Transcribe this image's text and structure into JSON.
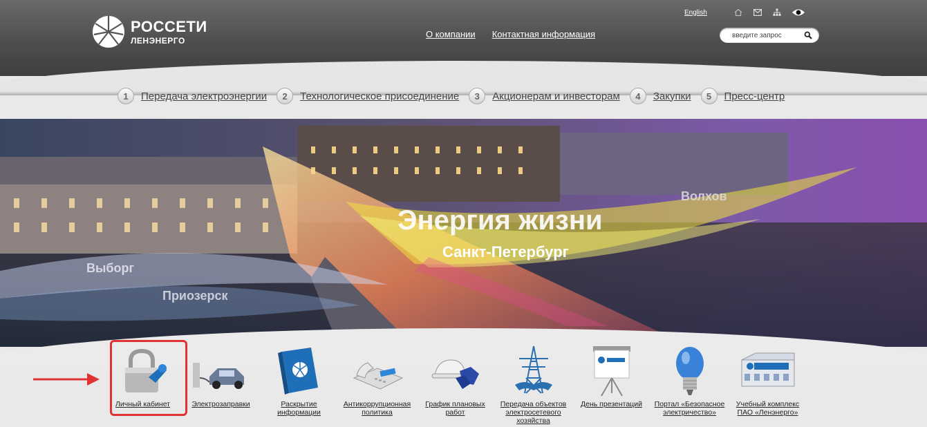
{
  "header": {
    "logo": {
      "title": "РОССЕТИ",
      "subtitle": "ЛЕНЭНЕРГО"
    },
    "links": [
      {
        "label": "О компании"
      },
      {
        "label": "Контактная информация"
      }
    ],
    "language_link": "English",
    "utility_icons": [
      "home-icon",
      "mail-icon",
      "sitemap-icon",
      "eye-icon"
    ],
    "search": {
      "placeholder": "введите запрос",
      "icon": "search-icon"
    }
  },
  "main_nav": [
    {
      "num": "1",
      "label": "Передача электроэнергии"
    },
    {
      "num": "2",
      "label": "Технологическое присоединение"
    },
    {
      "num": "3",
      "label": "Акционерам и инвесторам"
    },
    {
      "num": "4",
      "label": "Закупки"
    },
    {
      "num": "5",
      "label": "Пресс-центр"
    }
  ],
  "banner": {
    "slogan": "Энергия жизни",
    "cities": [
      "Санкт-Петербург",
      "Волхов",
      "Выборг",
      "Приозерск"
    ]
  },
  "tiles": [
    {
      "label": "Личный кабинет",
      "icon": "padlock-key-icon",
      "highlighted": true
    },
    {
      "label": "Электрозаправки",
      "icon": "ev-charging-car-icon"
    },
    {
      "label": "Раскрытие информации",
      "icon": "book-icon"
    },
    {
      "label": "Антикоррупционная политика",
      "icon": "phone-icon"
    },
    {
      "label": "График плановых работ",
      "icon": "hardhat-gloves-icon"
    },
    {
      "label": "Передача объектов электросетевого хозяйства",
      "icon": "power-tower-handshake-icon"
    },
    {
      "label": "День презентаций",
      "icon": "presentation-board-icon"
    },
    {
      "label": "Портал «Безопасное электричество»",
      "icon": "lightbulb-icon"
    },
    {
      "label": "Учебный комплекс ПАО «Ленэнерго»",
      "icon": "building-icon"
    }
  ],
  "colors": {
    "highlight": "#e03232",
    "brand_blue": "#1f6fb8"
  }
}
